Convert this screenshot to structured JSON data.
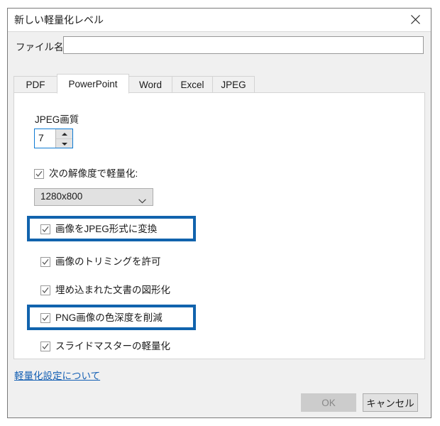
{
  "dialog": {
    "title": "新しい軽量化レベル",
    "close_icon": "close-icon"
  },
  "filename": {
    "label": "ファイル名:",
    "value": "",
    "placeholder": ""
  },
  "tabs": [
    {
      "label": "PDF",
      "selected": false
    },
    {
      "label": "PowerPoint",
      "selected": true
    },
    {
      "label": "Word",
      "selected": false
    },
    {
      "label": "Excel",
      "selected": false
    },
    {
      "label": "JPEG",
      "selected": false
    }
  ],
  "panel": {
    "quality": {
      "label": "JPEG画質",
      "value": "7",
      "up_icon": "arrow-up-icon",
      "down_icon": "arrow-down-icon"
    },
    "resolution": {
      "checkbox_label": "次の解像度で軽量化:",
      "checked": true,
      "selected_option": "1280x800",
      "options": [
        "1280x800"
      ],
      "chevron_icon": "chevron-down-icon"
    },
    "options": [
      {
        "label": "画像をJPEG形式に変換",
        "checked": true,
        "highlighted": true
      },
      {
        "label": "画像のトリミングを許可",
        "checked": true,
        "highlighted": false
      },
      {
        "label": "埋め込まれた文書の図形化",
        "checked": true,
        "highlighted": false
      },
      {
        "label": "PNG画像の色深度を削減",
        "checked": true,
        "highlighted": true
      },
      {
        "label": "スライドマスターの軽量化",
        "checked": true,
        "highlighted": false
      }
    ]
  },
  "footer": {
    "help_link": "軽量化設定について",
    "ok_label": "OK",
    "cancel_label": "キャンセル"
  },
  "colors": {
    "highlight": "#1163ad",
    "link": "#1560b4",
    "focus_border": "#0f7bd4"
  }
}
